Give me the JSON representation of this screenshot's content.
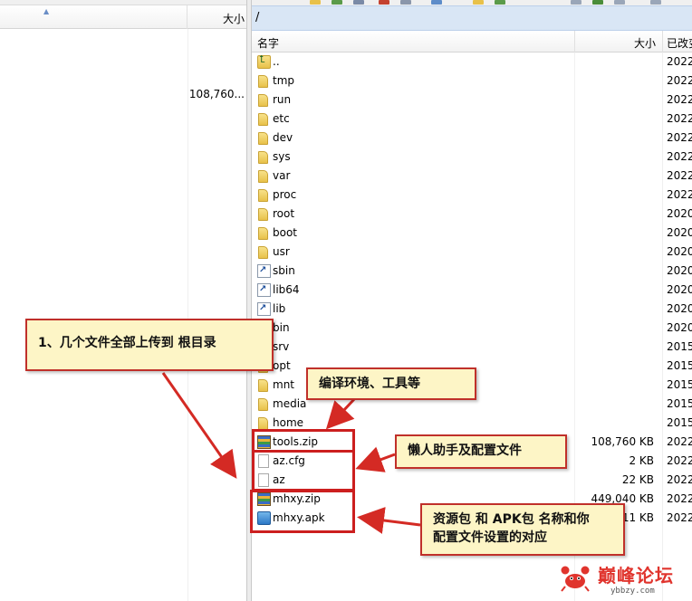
{
  "left_pane": {
    "columns": {
      "size": "大小"
    },
    "size_value": "108,760..."
  },
  "right_pane": {
    "path": "/",
    "columns": {
      "name": "名字",
      "size": "大小",
      "modified": "已改变"
    },
    "rows": [
      {
        "name": "..",
        "type": "parent",
        "size": "",
        "date": "2022"
      },
      {
        "name": "tmp",
        "type": "folder",
        "size": "",
        "date": "2022"
      },
      {
        "name": "run",
        "type": "folder",
        "size": "",
        "date": "2022"
      },
      {
        "name": "etc",
        "type": "folder",
        "size": "",
        "date": "2022"
      },
      {
        "name": "dev",
        "type": "folder",
        "size": "",
        "date": "2022"
      },
      {
        "name": "sys",
        "type": "folder",
        "size": "",
        "date": "2022"
      },
      {
        "name": "var",
        "type": "folder",
        "size": "",
        "date": "2022"
      },
      {
        "name": "proc",
        "type": "folder",
        "size": "",
        "date": "2022"
      },
      {
        "name": "root",
        "type": "folder",
        "size": "",
        "date": "2020"
      },
      {
        "name": "boot",
        "type": "folder",
        "size": "",
        "date": "2020"
      },
      {
        "name": "usr",
        "type": "folder",
        "size": "",
        "date": "2020"
      },
      {
        "name": "sbin",
        "type": "link",
        "size": "",
        "date": "2020"
      },
      {
        "name": "lib64",
        "type": "link",
        "size": "",
        "date": "2020"
      },
      {
        "name": "lib",
        "type": "link",
        "size": "",
        "date": "2020"
      },
      {
        "name": "bin",
        "type": "link",
        "size": "",
        "date": "2020"
      },
      {
        "name": "srv",
        "type": "folder",
        "size": "",
        "date": "2015"
      },
      {
        "name": "opt",
        "type": "folder",
        "size": "",
        "date": "2015"
      },
      {
        "name": "mnt",
        "type": "folder",
        "size": "",
        "date": "2015"
      },
      {
        "name": "media",
        "type": "folder",
        "size": "",
        "date": "2015"
      },
      {
        "name": "home",
        "type": "folder",
        "size": "",
        "date": "2015"
      },
      {
        "name": "tools.zip",
        "type": "zip",
        "size": "108,760 KB",
        "date": "2022"
      },
      {
        "name": "az.cfg",
        "type": "file",
        "size": "2 KB",
        "date": "2022"
      },
      {
        "name": "az",
        "type": "file",
        "size": "22 KB",
        "date": "2022"
      },
      {
        "name": "mhxy.zip",
        "type": "zip",
        "size": "449,040 KB",
        "date": "2022"
      },
      {
        "name": "mhxy.apk",
        "type": "apk",
        "size": "11 KB",
        "date": "2022"
      }
    ]
  },
  "annotations": {
    "upload_note": "1、几个文件全部上传到 根目录",
    "tools_note": "编译环境、工具等",
    "config_note": "懒人助手及配置文件",
    "resource_note_line1": "资源包 和 APK包 名称和你",
    "resource_note_line2": "配置文件设置的对应"
  },
  "watermark": {
    "text": "巅峰论坛",
    "url": "ybbzy.com"
  },
  "colors": {
    "highlight_red": "#cc1f1f",
    "callout_bg": "#fdf5c6",
    "path_bar": "#d9e6f5"
  }
}
